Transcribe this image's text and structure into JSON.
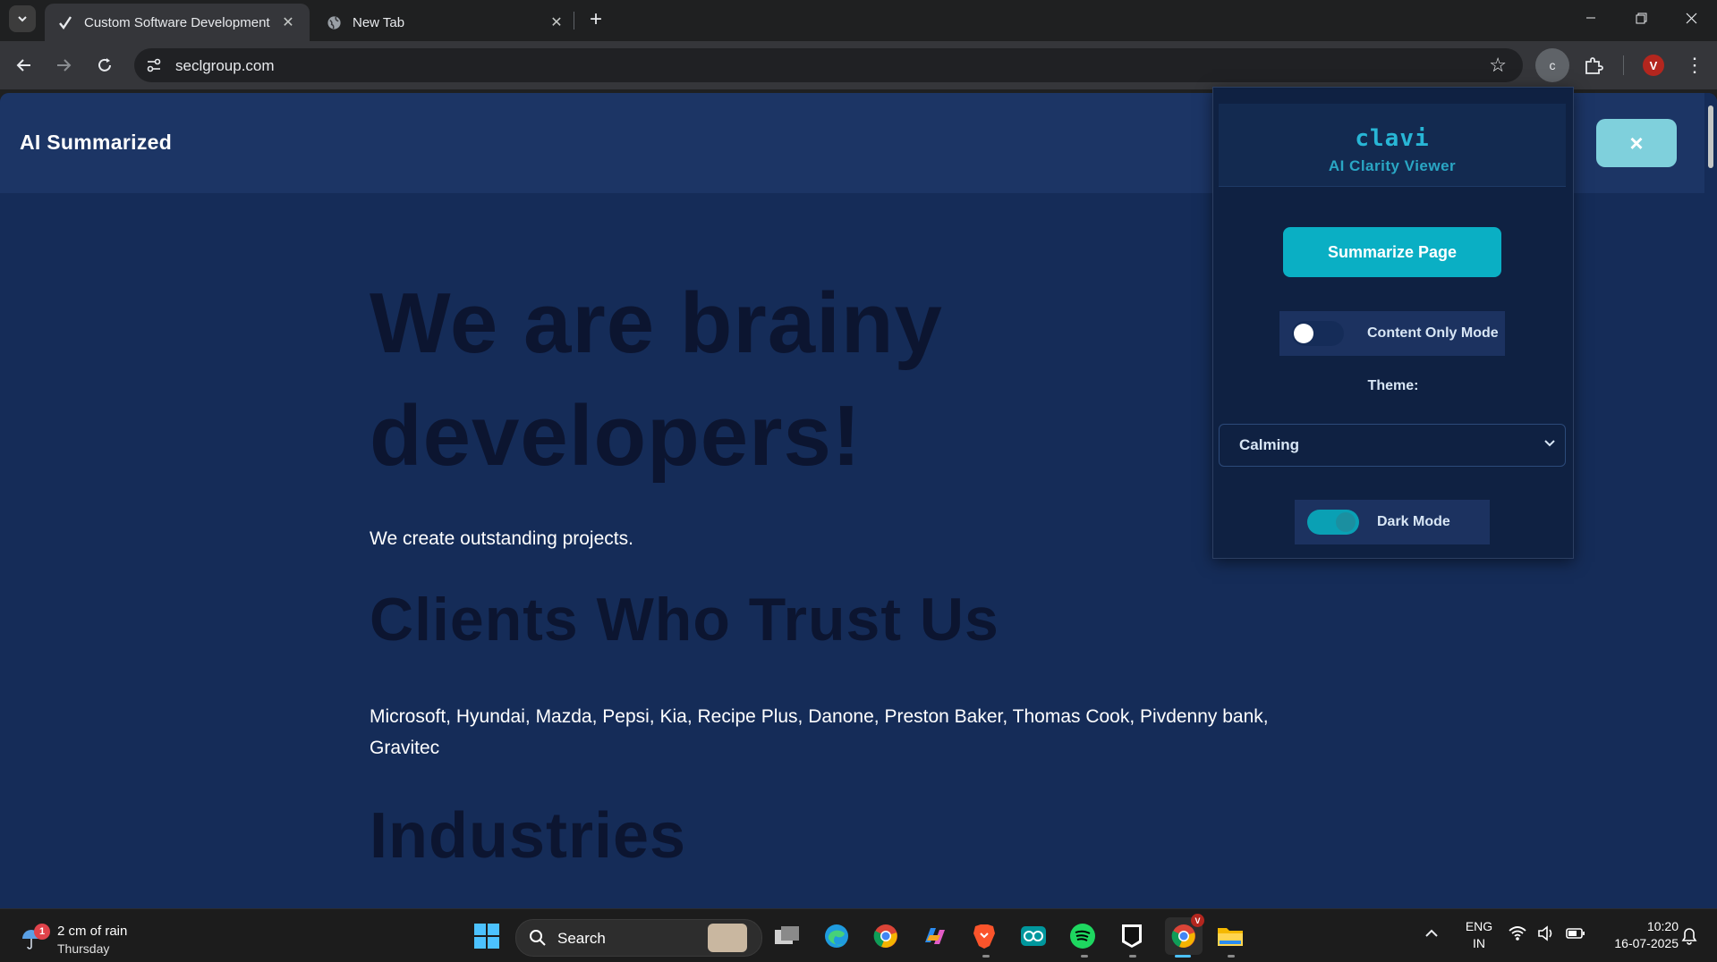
{
  "browser": {
    "tabs": [
      {
        "title": "Custom Software Development",
        "active": true,
        "favicon": "seclgroup-favicon-icon"
      },
      {
        "title": "New Tab",
        "active": false,
        "favicon": "globe-icon"
      }
    ],
    "new_tab_label": "+",
    "url": "seclgroup.com",
    "extension_letter": "c",
    "profile_initial": "V"
  },
  "page": {
    "header_brand": "AI Summarized",
    "close_label": "×",
    "headline": "We are brainy developers!",
    "subheadline": "We create outstanding projects.",
    "clients_heading": "Clients Who Trust Us",
    "clients_text": "Microsoft, Hyundai, Mazda, Pepsi, Kia, Recipe Plus, Danone, Preston Baker, Thomas Cook, Pivdenny bank, Gravitec",
    "industries_heading": "Industries"
  },
  "popup": {
    "name": "clavi",
    "tagline": "AI Clarity Viewer",
    "summarize_label": "Summarize Page",
    "content_only_label": "Content Only Mode",
    "content_only_on": false,
    "theme_label": "Theme:",
    "theme_value": "Calming",
    "dark_mode_label": "Dark Mode",
    "dark_mode_on": true
  },
  "taskbar": {
    "weather_line1": "2 cm of rain",
    "weather_line2": "Thursday",
    "weather_badge": "1",
    "search_placeholder": "Search",
    "lang_line1": "ENG",
    "lang_line2": "IN",
    "time": "10:20",
    "date": "16-07-2025",
    "chrome_badge": "V"
  },
  "colors": {
    "accent": "#0aafc4",
    "page_bg": "#152c58",
    "header_bg": "#1c3565",
    "heading_dark": "#0c1530"
  }
}
